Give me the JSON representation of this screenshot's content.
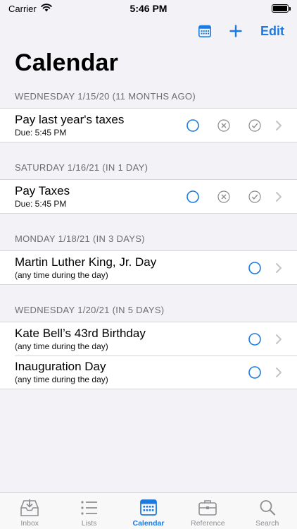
{
  "status_bar": {
    "carrier": "Carrier",
    "time": "5:46 PM"
  },
  "nav": {
    "edit_label": "Edit",
    "add_label": "+"
  },
  "title": "Calendar",
  "sections": [
    {
      "header": "WEDNESDAY 1/15/20 (11 MONTHS AGO)",
      "items": [
        {
          "title": "Pay last year's taxes",
          "subtitle": "Due: 5:45 PM",
          "full_actions": true
        }
      ]
    },
    {
      "header": "SATURDAY 1/16/21 (IN 1 DAY)",
      "items": [
        {
          "title": "Pay Taxes",
          "subtitle": "Due: 5:45 PM",
          "full_actions": true
        }
      ]
    },
    {
      "header": "MONDAY 1/18/21 (IN 3 DAYS)",
      "items": [
        {
          "title": "Martin Luther King, Jr. Day",
          "subtitle": "(any time during the day)",
          "full_actions": false
        }
      ]
    },
    {
      "header": "WEDNESDAY 1/20/21 (IN 5 DAYS)",
      "items": [
        {
          "title": "Kate Bell’s 43rd Birthday",
          "subtitle": "(any time during the day)",
          "full_actions": false
        },
        {
          "title": "Inauguration Day",
          "subtitle": "(any time during the day)",
          "full_actions": false
        }
      ]
    }
  ],
  "tabs": [
    {
      "label": "Inbox",
      "icon": "inbox-icon",
      "active": false
    },
    {
      "label": "Lists",
      "icon": "list-icon",
      "active": false
    },
    {
      "label": "Calendar",
      "icon": "calendar-icon",
      "active": true
    },
    {
      "label": "Reference",
      "icon": "briefcase-icon",
      "active": false
    },
    {
      "label": "Search",
      "icon": "search-icon",
      "active": false
    }
  ],
  "colors": {
    "accent": "#1a7ae0",
    "inactive": "#8e8e93",
    "background": "#f2f2f7"
  }
}
